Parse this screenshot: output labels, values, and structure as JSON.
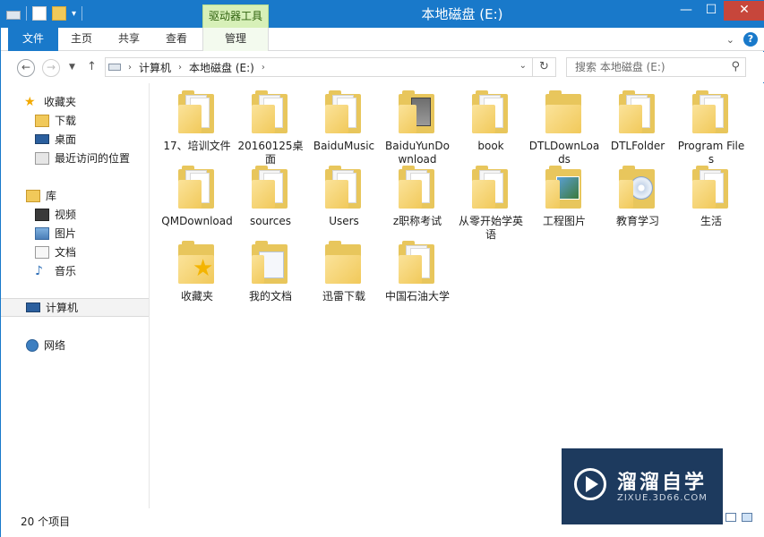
{
  "window": {
    "title": "本地磁盘 (E:)",
    "context_tab": "驱动器工具"
  },
  "ribbon": {
    "tabs": [
      "文件",
      "主页",
      "共享",
      "查看",
      "管理"
    ]
  },
  "address_bar": {
    "crumbs": [
      "计算机",
      "本地磁盘 (E:)"
    ],
    "search_placeholder": "搜索 本地磁盘 (E:)"
  },
  "nav_pane": {
    "favorites": "收藏夹",
    "downloads": "下载",
    "desktop": "桌面",
    "recent": "最近访问的位置",
    "libraries": "库",
    "videos": "视频",
    "pictures": "图片",
    "documents": "文档",
    "music": "音乐",
    "computer": "计算机",
    "network": "网络"
  },
  "files": [
    {
      "name": "17、培训文件",
      "icon": "folder-paper"
    },
    {
      "name": "20160125桌面",
      "icon": "folder-paper"
    },
    {
      "name": "BaiduMusic",
      "icon": "folder-paper"
    },
    {
      "name": "BaiduYunDownload",
      "icon": "folder-photo"
    },
    {
      "name": "book",
      "icon": "folder-paper"
    },
    {
      "name": "DTLDownLoads",
      "icon": "folder"
    },
    {
      "name": "DTLFolder",
      "icon": "folder-paper"
    },
    {
      "name": "Program Files",
      "icon": "folder-paper"
    },
    {
      "name": "QMDownload",
      "icon": "folder-paper"
    },
    {
      "name": "sources",
      "icon": "folder-paper"
    },
    {
      "name": "Users",
      "icon": "folder-paper"
    },
    {
      "name": "z职称考试",
      "icon": "folder-paper"
    },
    {
      "name": "从零开始学英语",
      "icon": "folder-paper"
    },
    {
      "name": "工程图片",
      "icon": "folder-image"
    },
    {
      "name": "教育学习",
      "icon": "folder-disc"
    },
    {
      "name": "生活",
      "icon": "folder-paper"
    },
    {
      "name": "收藏夹",
      "icon": "folder-star"
    },
    {
      "name": "我的文档",
      "icon": "folder-docs"
    },
    {
      "name": "迅雷下载",
      "icon": "folder"
    },
    {
      "name": "中国石油大学",
      "icon": "folder-paper"
    }
  ],
  "status": {
    "item_count": "20 个项目"
  },
  "watermark": {
    "title": "溜溜自学",
    "subtitle": "ZIXUE.3D66.COM"
  }
}
